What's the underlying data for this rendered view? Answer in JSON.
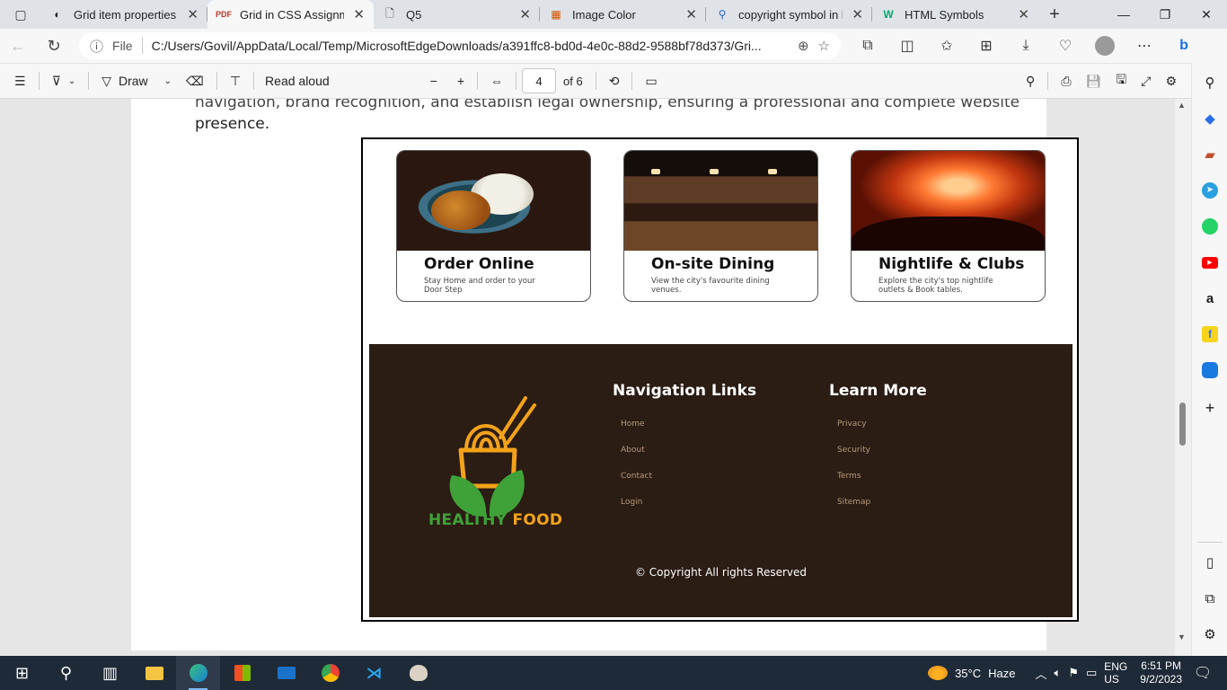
{
  "browser": {
    "tabs": [
      {
        "title": "Grid item properties - ",
        "icon": "globe-icon",
        "active": false
      },
      {
        "title": "Grid in CSS Assignmen",
        "icon": "pdf-icon",
        "active": true
      },
      {
        "title": "Q5",
        "icon": "document-icon",
        "active": false
      },
      {
        "title": "Image Color",
        "icon": "color-grid-icon",
        "active": false
      },
      {
        "title": "copyright symbol in ht",
        "icon": "search-icon",
        "active": false
      },
      {
        "title": "HTML Symbols",
        "icon": "w3schools-icon",
        "active": false
      }
    ],
    "address": {
      "scheme_label": "File",
      "url": "C:/Users/Govil/AppData/Local/Temp/MicrosoftEdgeDownloads/a391ffc8-bd0d-4e0c-88d2-9588bf78d373/Gri..."
    }
  },
  "pdf_toolbar": {
    "draw_label": "Draw",
    "read_aloud_label": "Read aloud",
    "current_page": "4",
    "page_total": "of 6"
  },
  "pdf_page": {
    "partial_line": "navigation, brand recognition, and establish legal ownership, ensuring a professional and complete website",
    "last_line": "presence.",
    "cards": [
      {
        "title": "Order Online",
        "desc": "Stay Home and order to your Door Step"
      },
      {
        "title": "On-site Dining",
        "desc": "View the city's favourite dining venues."
      },
      {
        "title": "Nightlife & Clubs",
        "desc": "Explore the city's top nightlife outlets & Book tables."
      }
    ],
    "footer": {
      "logo_word1": "HEALTHY",
      "logo_word2": "FOOD",
      "nav_heading": "Navigation Links",
      "nav_links": [
        "Home",
        "About",
        "Contact",
        "Login"
      ],
      "learn_heading": "Learn More",
      "learn_links": [
        "Privacy",
        "Security",
        "Terms",
        "Sitemap"
      ],
      "copyright": "© Copyright All rights Reserved"
    }
  },
  "taskbar": {
    "weather_temp": "35°C",
    "weather_desc": "Haze",
    "lang_top": "ENG",
    "lang_bottom": "US",
    "time": "6:51 PM",
    "date": "9/2/2023"
  },
  "colors": {
    "footer_bg": "#2b1c14",
    "logo_green": "#3fa238",
    "logo_orange": "#f2a31a",
    "taskbar_bg": "#1f2a38"
  }
}
